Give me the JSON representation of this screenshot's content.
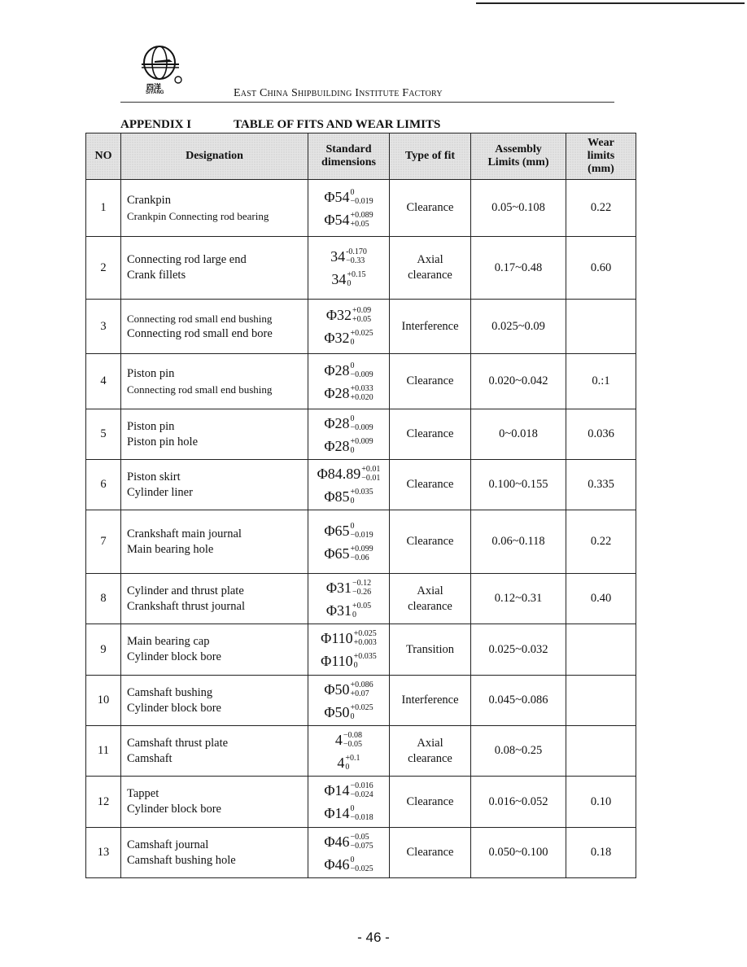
{
  "header": {
    "logo_cn": "四洋",
    "logo_en": "SIYANG",
    "factory": "East China Shipbuilding Institute Factory",
    "appendix": "APPENDIX I",
    "table_title": "TABLE OF FITS AND WEAR LIMITS"
  },
  "table": {
    "columns": [
      "NO",
      "Designation",
      "Standard dimensions",
      "Type of fit",
      "Assembly Limits (mm)",
      "Wear limits (mm)"
    ],
    "rows": [
      {
        "no": "1",
        "des": [
          "Crankpin",
          "Crankpin Connecting rod bearing"
        ],
        "dims": [
          {
            "base": "Φ54",
            "up": "0",
            "low": "−0.019"
          },
          {
            "base": "Φ54",
            "up": "+0.089",
            "low": "+0.05"
          }
        ],
        "fit": [
          "Clearance"
        ],
        "asm": "0.05~0.108",
        "wear": "0.22"
      },
      {
        "no": "2",
        "des": [
          "Connecting rod large end",
          "Crank fillets"
        ],
        "dims": [
          {
            "base": "34",
            "up": "-0.170",
            "low": "−0.33"
          },
          {
            "base": "34",
            "up": "+0.15",
            "low": "0"
          }
        ],
        "fit": [
          "Axial",
          "clearance"
        ],
        "asm": "0.17~0.48",
        "wear": "0.60"
      },
      {
        "no": "3",
        "des": [
          "Connecting rod small end bushing",
          "Connecting rod small end bore"
        ],
        "dims": [
          {
            "base": "Φ32",
            "up": "+0.09",
            "low": "+0.05"
          },
          {
            "base": "Φ32",
            "up": "+0.025",
            "low": "0"
          }
        ],
        "fit": [
          "Interference"
        ],
        "asm": "0.025~0.09",
        "wear": ""
      },
      {
        "no": "4",
        "des": [
          "Piston pin",
          "Connecting rod small end bushing"
        ],
        "dims": [
          {
            "base": "Φ28",
            "up": "0",
            "low": "−0.009"
          },
          {
            "base": "Φ28",
            "up": "+0.033",
            "low": "+0.020"
          }
        ],
        "fit": [
          "Clearance"
        ],
        "asm": "0.020~0.042",
        "wear": "0.:1"
      },
      {
        "no": "5",
        "des": [
          "Piston pin",
          "Piston pin hole"
        ],
        "dims": [
          {
            "base": "Φ28",
            "up": "0",
            "low": "−0.009"
          },
          {
            "base": "Φ28",
            "up": "+0.009",
            "low": "0"
          }
        ],
        "fit": [
          "Clearance"
        ],
        "asm": "0~0.018",
        "wear": "0.036"
      },
      {
        "no": "6",
        "des": [
          "Piston skirt",
          "Cylinder liner"
        ],
        "dims": [
          {
            "base": "Φ84.89",
            "up": "+0.01",
            "low": "−0.01"
          },
          {
            "base": "Φ85",
            "up": "+0.035",
            "low": "0"
          }
        ],
        "fit": [
          "Clearance"
        ],
        "asm": "0.100~0.155",
        "wear": "0.335"
      },
      {
        "no": "7",
        "des": [
          "Crankshaft main journal",
          "Main bearing hole"
        ],
        "dims": [
          {
            "base": "Φ65",
            "up": "0",
            "low": "−0.019"
          },
          {
            "base": "Φ65",
            "up": "+0.099",
            "low": "−0.06"
          }
        ],
        "fit": [
          "Clearance"
        ],
        "asm": "0.06~0.118",
        "wear": "0.22"
      },
      {
        "no": "8",
        "des": [
          "Cylinder and thrust plate",
          "Crankshaft thrust journal"
        ],
        "dims": [
          {
            "base": "Φ31",
            "up": "−0.12",
            "low": "−0.26"
          },
          {
            "base": "Φ31",
            "up": "+0.05",
            "low": "0"
          }
        ],
        "fit": [
          "Axial",
          "clearance"
        ],
        "asm": "0.12~0.31",
        "wear": "0.40"
      },
      {
        "no": "9",
        "des": [
          "Main bearing cap",
          "Cylinder block bore"
        ],
        "dims": [
          {
            "base": "Φ110",
            "up": "+0.025",
            "low": "+0.003"
          },
          {
            "base": "Φ110",
            "up": "+0.035",
            "low": "0"
          }
        ],
        "fit": [
          "Transition"
        ],
        "asm": "0.025~0.032",
        "wear": ""
      },
      {
        "no": "10",
        "des": [
          "Camshaft bushing",
          "Cylinder block bore"
        ],
        "dims": [
          {
            "base": "Φ50",
            "up": "+0.086",
            "low": "+0.07"
          },
          {
            "base": "Φ50",
            "up": "+0.025",
            "low": "0"
          }
        ],
        "fit": [
          "Interference"
        ],
        "asm": "0.045~0.086",
        "wear": ""
      },
      {
        "no": "11",
        "des": [
          "Camshaft thrust plate",
          "Camshaft"
        ],
        "dims": [
          {
            "base": "4",
            "up": "−0.08",
            "low": "−0.05"
          },
          {
            "base": "4",
            "up": "+0.1",
            "low": "0"
          }
        ],
        "fit": [
          "Axial",
          "clearance"
        ],
        "asm": "0.08~0.25",
        "wear": ""
      },
      {
        "no": "12",
        "des": [
          "Tappet",
          "Cylinder block bore"
        ],
        "dims": [
          {
            "base": "Φ14",
            "up": "−0.016",
            "low": "−0.024"
          },
          {
            "base": "Φ14",
            "up": "0",
            "low": "−0.018"
          }
        ],
        "fit": [
          "Clearance"
        ],
        "asm": "0.016~0.052",
        "wear": "0.10"
      },
      {
        "no": "13",
        "des": [
          "Camshaft journal",
          "Camshaft bushing hole"
        ],
        "dims": [
          {
            "base": "Φ46",
            "up": "−0.05",
            "low": "−0.075"
          },
          {
            "base": "Φ46",
            "up": "0",
            "low": "−0.025"
          }
        ],
        "fit": [
          "Clearance"
        ],
        "asm": "0.050~0.100",
        "wear": "0.18"
      }
    ]
  },
  "footer": {
    "page_number": "- 46 -"
  }
}
